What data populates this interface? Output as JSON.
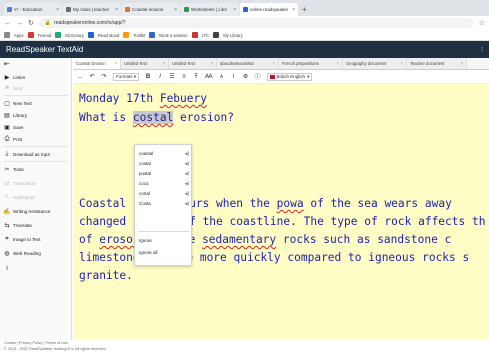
{
  "browser": {
    "tabs": [
      {
        "label": "Yr - Education",
        "color": "#4a7dd8",
        "active": false
      },
      {
        "label": "My class | teacher",
        "color": "#6a6a6a",
        "active": false
      },
      {
        "label": "Coastal erosion",
        "color": "#e0742c",
        "active": false
      },
      {
        "label": "Worksheets | Liter",
        "color": "#2a9a4a",
        "active": false
      },
      {
        "label": "online readspeaker",
        "color": "#2266cc",
        "active": true
      }
    ],
    "new_tab": "+",
    "url": "readspeakeronline.com/rs/app/?",
    "bookmarks": [
      "Apps",
      "TextAid",
      "Dictionary",
      "Read aloud",
      "Toolkit",
      "Book a session",
      "LTC",
      "My Library"
    ]
  },
  "app": {
    "title": "ReadSpeaker TextAid",
    "menu_glyph": "⁝"
  },
  "sidebar": {
    "collapse_glyph": "⇤",
    "items": [
      {
        "label": "Listen",
        "icon": "▶",
        "disabled": false
      },
      {
        "label": "Stop",
        "icon": "■",
        "disabled": true
      },
      {
        "label": "New Text",
        "icon": "▢",
        "disabled": false
      },
      {
        "label": "Library",
        "icon": "▤",
        "disabled": false
      },
      {
        "label": "Save",
        "icon": "▣",
        "disabled": false
      },
      {
        "label": "Print",
        "icon": "⎙",
        "disabled": false
      },
      {
        "label": "Download as mp3",
        "icon": "⤓",
        "disabled": false
      },
      {
        "label": "Tools",
        "icon": "✂",
        "disabled": false
      },
      {
        "label": "Translation",
        "icon": "⇄",
        "disabled": true
      },
      {
        "label": "Highlighter",
        "icon": "✎",
        "disabled": true
      },
      {
        "label": "Writing Assistance",
        "icon": "✍",
        "disabled": false
      },
      {
        "label": "Translate",
        "icon": "⇆",
        "disabled": false
      },
      {
        "label": "Image to Text",
        "icon": "⌗",
        "disabled": false
      },
      {
        "label": "Web Reading",
        "icon": "◍",
        "disabled": false
      }
    ]
  },
  "doc_tabs": [
    {
      "label": "Coastal Erosion",
      "active": true
    },
    {
      "label": "Untitled Text",
      "active": false
    },
    {
      "label": "Untitled Text",
      "active": false
    },
    {
      "label": "abacoketsoundsto",
      "active": false
    },
    {
      "label": "French propositions",
      "active": false
    },
    {
      "label": "Geography document",
      "active": false
    },
    {
      "label": "Teacher document",
      "active": false
    }
  ],
  "toolbar": {
    "format_label": "Formats",
    "language_label": "British English"
  },
  "editor": {
    "line1": "Monday 17th ",
    "line1_err": "Febuery",
    "line2_pre": "What is ",
    "line2_hl": "costal",
    "line2_post": " erosion?",
    "line3_a": "Coastal ",
    "line3_b": "occurs when the ",
    "line3_err": "powa",
    "line3_c": " of the sea wears away",
    "line4_a": "changed ",
    "line4_b": "a of the coastline. The type of rock affects th",
    "line5_a": "of ",
    "line5_err": "erosor",
    "line5_b": "ample ",
    "line5_err2": "sedamentary",
    "line5_c": " rocks such as sandstone c",
    "line6_a": "limestone",
    "line6_b": "de more quickly compared to igneous rocks s",
    "line7": "granite."
  },
  "suggestions": {
    "items": [
      "coastal",
      "costal",
      "postal",
      "coca",
      "cortal",
      "Costa"
    ],
    "actions": [
      "Ignore",
      "Ignore all"
    ],
    "speak_glyph": "🔊"
  },
  "footer": {
    "links": "Cookie | Privacy Policy | Terms of Use",
    "copyright": "© 2013 - 2022 ReadSpeaker Holding B.V. All rights reserved."
  }
}
